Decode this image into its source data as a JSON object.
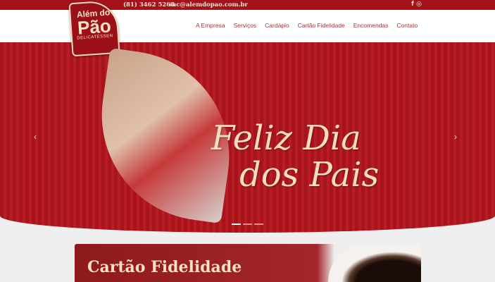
{
  "topbar": {
    "phone": "(81) 3462 5268",
    "email": "sac@alemdopao.com.br",
    "facebook": "f",
    "instagram": "◎"
  },
  "logo": {
    "line1": "Além do",
    "line2": "Pão",
    "line3": "DELICATESSEN"
  },
  "nav": [
    "A Empresa",
    "Serviços",
    "Cardápio",
    "Cartão Fidelidade",
    "Encomendas",
    "Contato"
  ],
  "hero": {
    "line1": "Feliz Dia",
    "line2": "dos Pais",
    "prev": "‹",
    "next": "›",
    "slides": 3,
    "active_slide": 1
  },
  "card": {
    "title": "Cartão Fidelidade"
  }
}
